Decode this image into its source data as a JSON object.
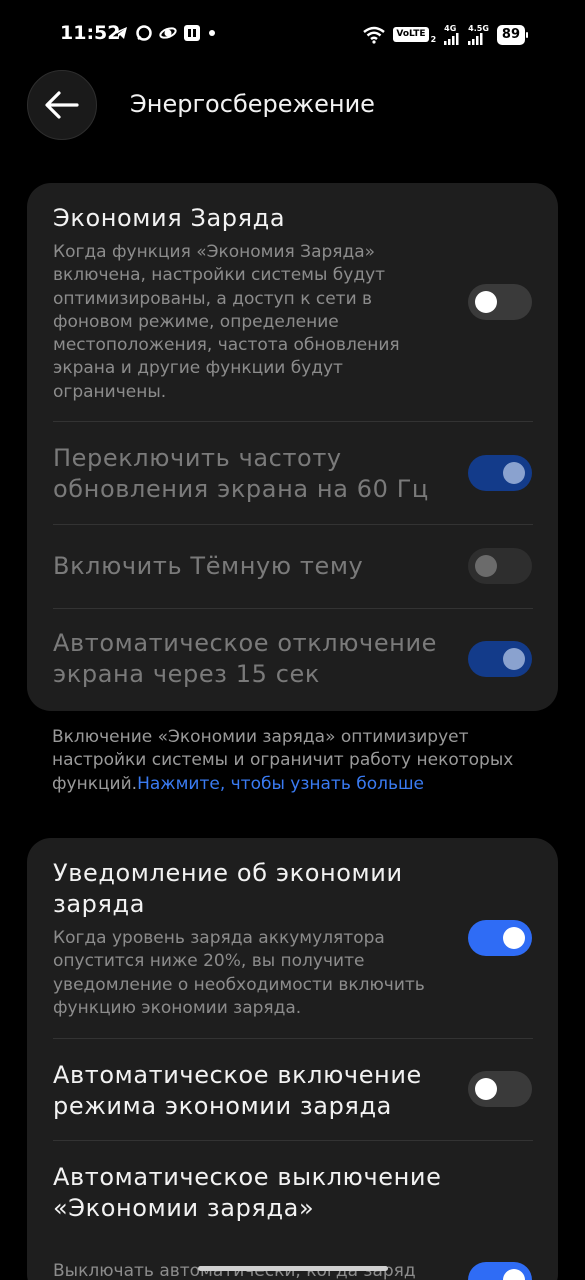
{
  "status_bar": {
    "time": "11:52",
    "volte": "VoLTE",
    "sim2": "2",
    "net1": "4G",
    "net2": "4.5G",
    "battery": "89"
  },
  "header": {
    "title": "Энергосбережение"
  },
  "battery_saver_card": {
    "main": {
      "title": "Экономия Заряда",
      "description": "Когда функция «Экономия Заряда» включена, настройки системы будут оптимизированы, а доступ к сети в фоновом режиме, определение местоположения, частота обновления экрана и другие функции будут ограничены.",
      "enabled": false
    },
    "options": [
      {
        "label": "Переключить частоту обновления экрана на 60 Гц",
        "enabled": true
      },
      {
        "label": "Включить Тёмную тему",
        "enabled": false
      },
      {
        "label": "Автоматическое отключение экрана через 15 сек",
        "enabled": true
      }
    ]
  },
  "note": {
    "text": "Включение «Экономии заряда» оптимизирует настройки системы и ограничит работу некоторых функций.",
    "link": "Нажмите, чтобы узнать больше"
  },
  "notification_card": {
    "items": [
      {
        "title": "Уведомление об экономии заряда",
        "description": "Когда уровень заряда аккумулятора опустится ниже 20%, вы получите уведомление о необходимости включить функцию экономии заряда.",
        "enabled": true
      },
      {
        "title": "Автоматическое включение режима экономии заряда",
        "enabled": false
      },
      {
        "title": "Автоматическое выключение «Экономии заряда»",
        "description": "Выключать автоматически, когда заряд",
        "enabled": true
      }
    ]
  },
  "colors": {
    "accent": "#2f6cf5",
    "card": "#1e1e1e",
    "background": "#000000",
    "link": "#3a7bf2"
  }
}
